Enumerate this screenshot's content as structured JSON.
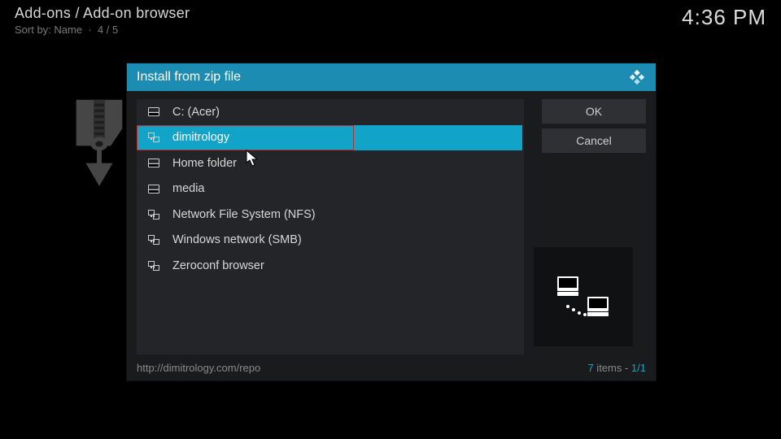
{
  "header": {
    "breadcrumb": "Add-ons / Add-on browser",
    "sort_prefix": "Sort by: ",
    "sort_value": "Name",
    "position": "4 / 5",
    "clock": "4:36 PM"
  },
  "dialog": {
    "title": "Install from zip file",
    "items": [
      {
        "label": "C: (Acer)",
        "icon": "drive",
        "selected": false
      },
      {
        "label": "dimitrology",
        "icon": "net",
        "selected": true
      },
      {
        "label": "Home folder",
        "icon": "drive",
        "selected": false
      },
      {
        "label": "media",
        "icon": "drive",
        "selected": false
      },
      {
        "label": "Network File System (NFS)",
        "icon": "net",
        "selected": false
      },
      {
        "label": "Windows network (SMB)",
        "icon": "net",
        "selected": false
      },
      {
        "label": "Zeroconf browser",
        "icon": "net",
        "selected": false
      }
    ],
    "buttons": {
      "ok": "OK",
      "cancel": "Cancel"
    },
    "footer_path": "http://dimitrology.com/repo",
    "footer_count_num": "7",
    "footer_count_word": " items - ",
    "footer_count_page": "1/1"
  }
}
